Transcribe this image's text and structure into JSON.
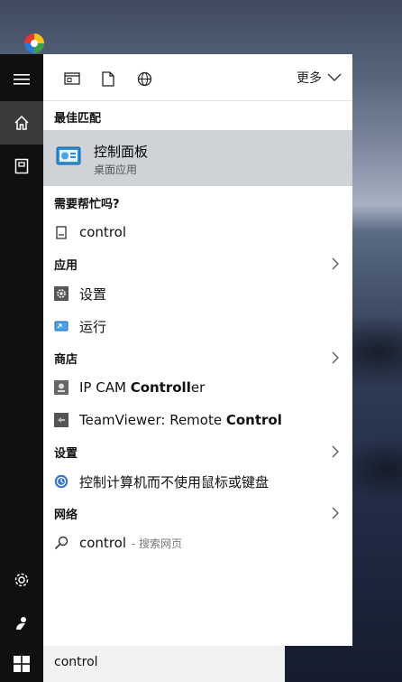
{
  "toolbar": {
    "icons": [
      "app-window-icon",
      "document-icon",
      "globe-icon"
    ],
    "more_label": "更多"
  },
  "rail": {
    "items": [
      "hamburger-menu-icon",
      "home-icon",
      "notebook-icon",
      "settings-gear-icon",
      "feedback-icon"
    ]
  },
  "best_match": {
    "heading": "最佳匹配",
    "title": "控制面板",
    "subtitle": "桌面应用"
  },
  "help": {
    "heading": "需要帮忙吗?",
    "items": [
      {
        "label": "control"
      }
    ]
  },
  "apps": {
    "heading": "应用",
    "items": [
      {
        "label": "设置"
      },
      {
        "label": "运行"
      }
    ]
  },
  "store": {
    "heading": "商店",
    "items": [
      {
        "pre": "IP CAM ",
        "bold": "Controll",
        "post": "er"
      },
      {
        "pre": "TeamViewer: Remote ",
        "bold": "Control",
        "post": ""
      }
    ]
  },
  "settings_section": {
    "heading": "设置",
    "items": [
      {
        "label": "控制计算机而不使用鼠标或键盘"
      }
    ]
  },
  "web": {
    "heading": "网络",
    "items": [
      {
        "label": "control",
        "hint": "- 搜索网页"
      }
    ]
  },
  "search": {
    "value": "control"
  },
  "colors": {
    "panel": "#ffffff",
    "rail": "#101010",
    "highlight": "#cfd3d8"
  }
}
